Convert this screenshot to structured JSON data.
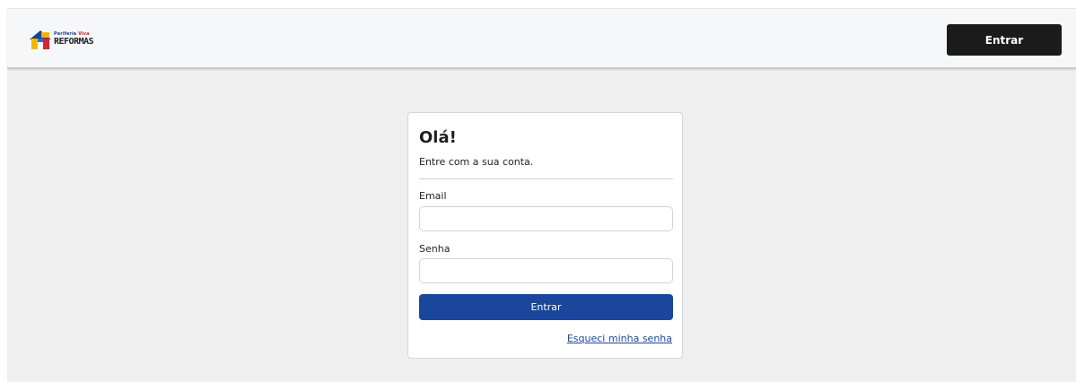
{
  "header": {
    "logo": {
      "top_line_a": "Periferia",
      "top_line_b": "Viva",
      "bottom_line": "REFORMAS"
    },
    "login_button_label": "Entrar"
  },
  "login_card": {
    "title": "Olá!",
    "subtitle": "Entre com a sua conta.",
    "email": {
      "label": "Email",
      "value": "",
      "placeholder": ""
    },
    "password": {
      "label": "Senha",
      "value": "",
      "placeholder": ""
    },
    "submit_label": "Entrar",
    "forgot_password_label": "Esqueci minha senha"
  },
  "colors": {
    "primary": "#1a479c",
    "dark_button": "#1b1b1b",
    "page_background": "#efefef",
    "header_background": "#f6f7f9"
  }
}
